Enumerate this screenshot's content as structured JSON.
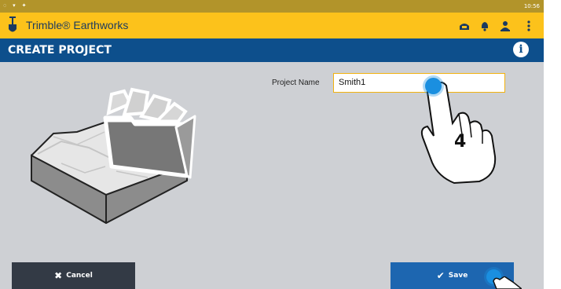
{
  "statusbar": {
    "time": "10:56"
  },
  "app": {
    "title": "Trimble® Earthworks"
  },
  "header": {
    "title": "CREATE PROJECT"
  },
  "form": {
    "project_name_label": "Project Name",
    "project_name_value": "Smith1"
  },
  "annotation": {
    "step_number": "4"
  },
  "buttons": {
    "cancel_label": "Cancel",
    "save_label": "Save"
  },
  "colors": {
    "app_bar": "#fcc21b",
    "title_bar": "#0d4f8c",
    "status_bar": "#b2942a",
    "background": "#ced0d4",
    "cancel_button": "#333a45",
    "save_button": "#1d66b0",
    "touch_indicator": "#1a8fe0"
  },
  "icons": [
    "shovel-logo-icon",
    "tablet-icon",
    "bell-icon",
    "person-icon",
    "overflow-menu-icon",
    "info-icon",
    "close-icon",
    "checkmark-icon"
  ]
}
